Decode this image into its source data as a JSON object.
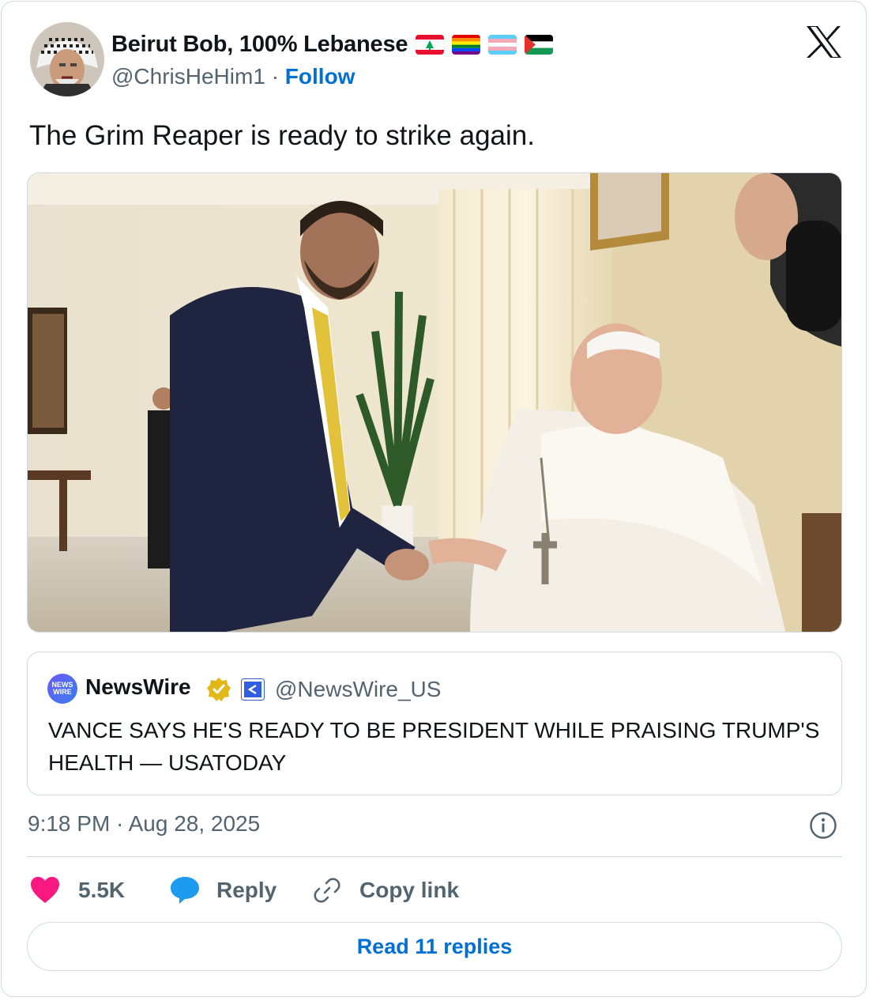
{
  "author": {
    "display_name": "Beirut Bob, 100% Lebanese",
    "flags": [
      "lebanon-flag-icon",
      "rainbow-flag-icon",
      "transgender-flag-icon",
      "palestine-flag-icon"
    ],
    "handle": "@ChrisHeHim1",
    "separator": "·",
    "follow_label": "Follow"
  },
  "tweet": {
    "text": "The Grim Reaper is ready to strike again.",
    "timestamp": "9:18 PM · Aug 28, 2025"
  },
  "quote": {
    "avatar_text": "NEWS WIRE",
    "name": "NewsWire",
    "handle": "@NewsWire_US",
    "text": "VANCE SAYS HE'S READY TO BE PRESIDENT WHILE PRAISING TRUMP'S HEALTH — USATODAY"
  },
  "actions": {
    "likes": "5.5K",
    "reply_label": "Reply",
    "copy_link_label": "Copy link",
    "read_replies_label": "Read 11 replies"
  },
  "colors": {
    "link_blue": "#006fd6",
    "like_pink": "#f91880",
    "reply_blue": "#1d9bf0",
    "secondary_text": "#536471",
    "border": "#cfd9de"
  }
}
